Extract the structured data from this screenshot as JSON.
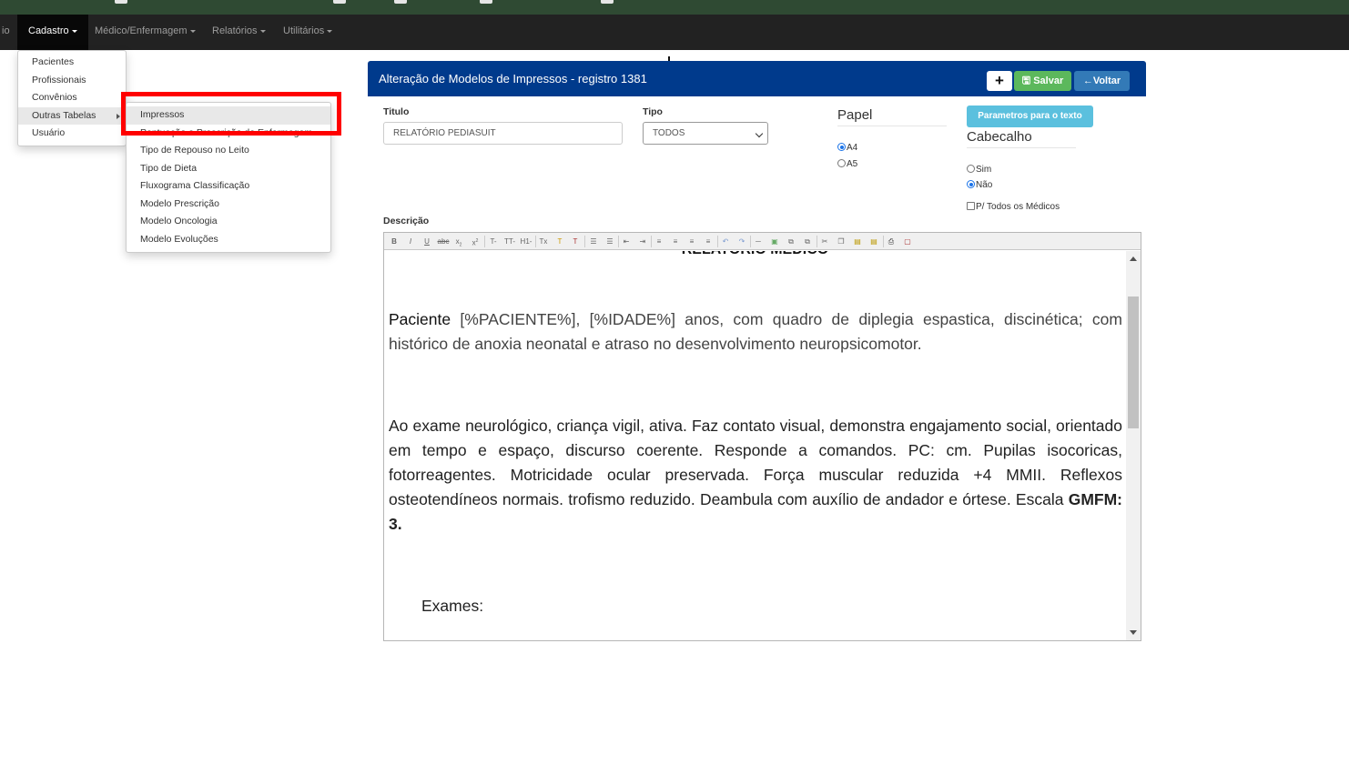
{
  "navbar": {
    "items": [
      {
        "label": "io"
      },
      {
        "label": "Cadastro"
      },
      {
        "label": "Médico/Enfermagem"
      },
      {
        "label": "Relatórios"
      },
      {
        "label": "Utilitários"
      }
    ]
  },
  "cadastro_menu": [
    "Pacientes",
    "Profissionais",
    "Convênios",
    "Outras Tabelas",
    "Usuário"
  ],
  "outras_tabelas_menu": [
    "Impressos",
    "Pontuação e Prescrição de Enfermagem",
    "Tipo de Repouso no Leito",
    "Tipo de Dieta",
    "Fluxograma Classificação",
    "Modelo Prescrição",
    "Modelo Oncologia",
    "Modelo Evoluções"
  ],
  "panel": {
    "title": "Alteração de Modelos de Impressos - registro 1381",
    "add_label": "+",
    "save_label": "Salvar",
    "back_label": "Voltar"
  },
  "form": {
    "titulo_label": "Titulo",
    "titulo_value": "RELATÓRIO PEDIASUIT",
    "tipo_label": "Tipo",
    "tipo_value": "TODOS",
    "papel_label": "Papel",
    "papel_options": [
      "A4",
      "A5"
    ],
    "papel_selected": "A4",
    "params_button": "Parametros para o texto",
    "cabecalho_label": "Cabecalho",
    "cabecalho_options": [
      "Sim",
      "Não"
    ],
    "cabecalho_selected": "Não",
    "todos_medicos_label": "P/ Todos os Médicos",
    "todos_medicos_checked": false,
    "descricao_label": "Descrição"
  },
  "editor": {
    "toolbar_icons": [
      "bold-icon",
      "italic-icon",
      "underline-icon",
      "strikethrough-icon",
      "subscript-icon",
      "superscript-icon",
      "font-icon",
      "font-size-icon",
      "heading-icon",
      "clear-format-icon",
      "text-color-icon",
      "background-color-icon",
      "unordered-list-icon",
      "ordered-list-icon",
      "outdent-icon",
      "indent-icon",
      "align-left-icon",
      "align-center-icon",
      "align-right-icon",
      "justify-icon",
      "undo-icon",
      "redo-icon",
      "horizontal-rule-icon",
      "image-icon",
      "link-icon",
      "unlink-icon",
      "cut-icon",
      "copy-icon",
      "paste-icon",
      "paste-text-icon",
      "print-icon",
      "source-icon"
    ],
    "heading": "RELATÓRIO MÉDICO",
    "p1_strong": "Paciente",
    "p1_rest": " [%PACIENTE%],  [%IDADE%] anos, com quadro de diplegia espastica, discinética; com histórico de anoxia neonatal e atraso no desenvolvimento neuropsicomotor.",
    "p2_text": "Ao exame neurológico, criança vigil, ativa. Faz contato visual, demonstra engajamento social, orientado em tempo e espaço, discurso coerente. Responde a comandos. PC: cm. Pupilas isocoricas, fotorreagentes. Motricidade ocular preservada. Força muscular reduzida +4 MMII. Reflexos osteotendíneos normais. trofismo reduzido. Deambula com auxílio de andador e órtese. Escala ",
    "p2_strong": "GMFM: 3.",
    "p3": "Exames:"
  }
}
